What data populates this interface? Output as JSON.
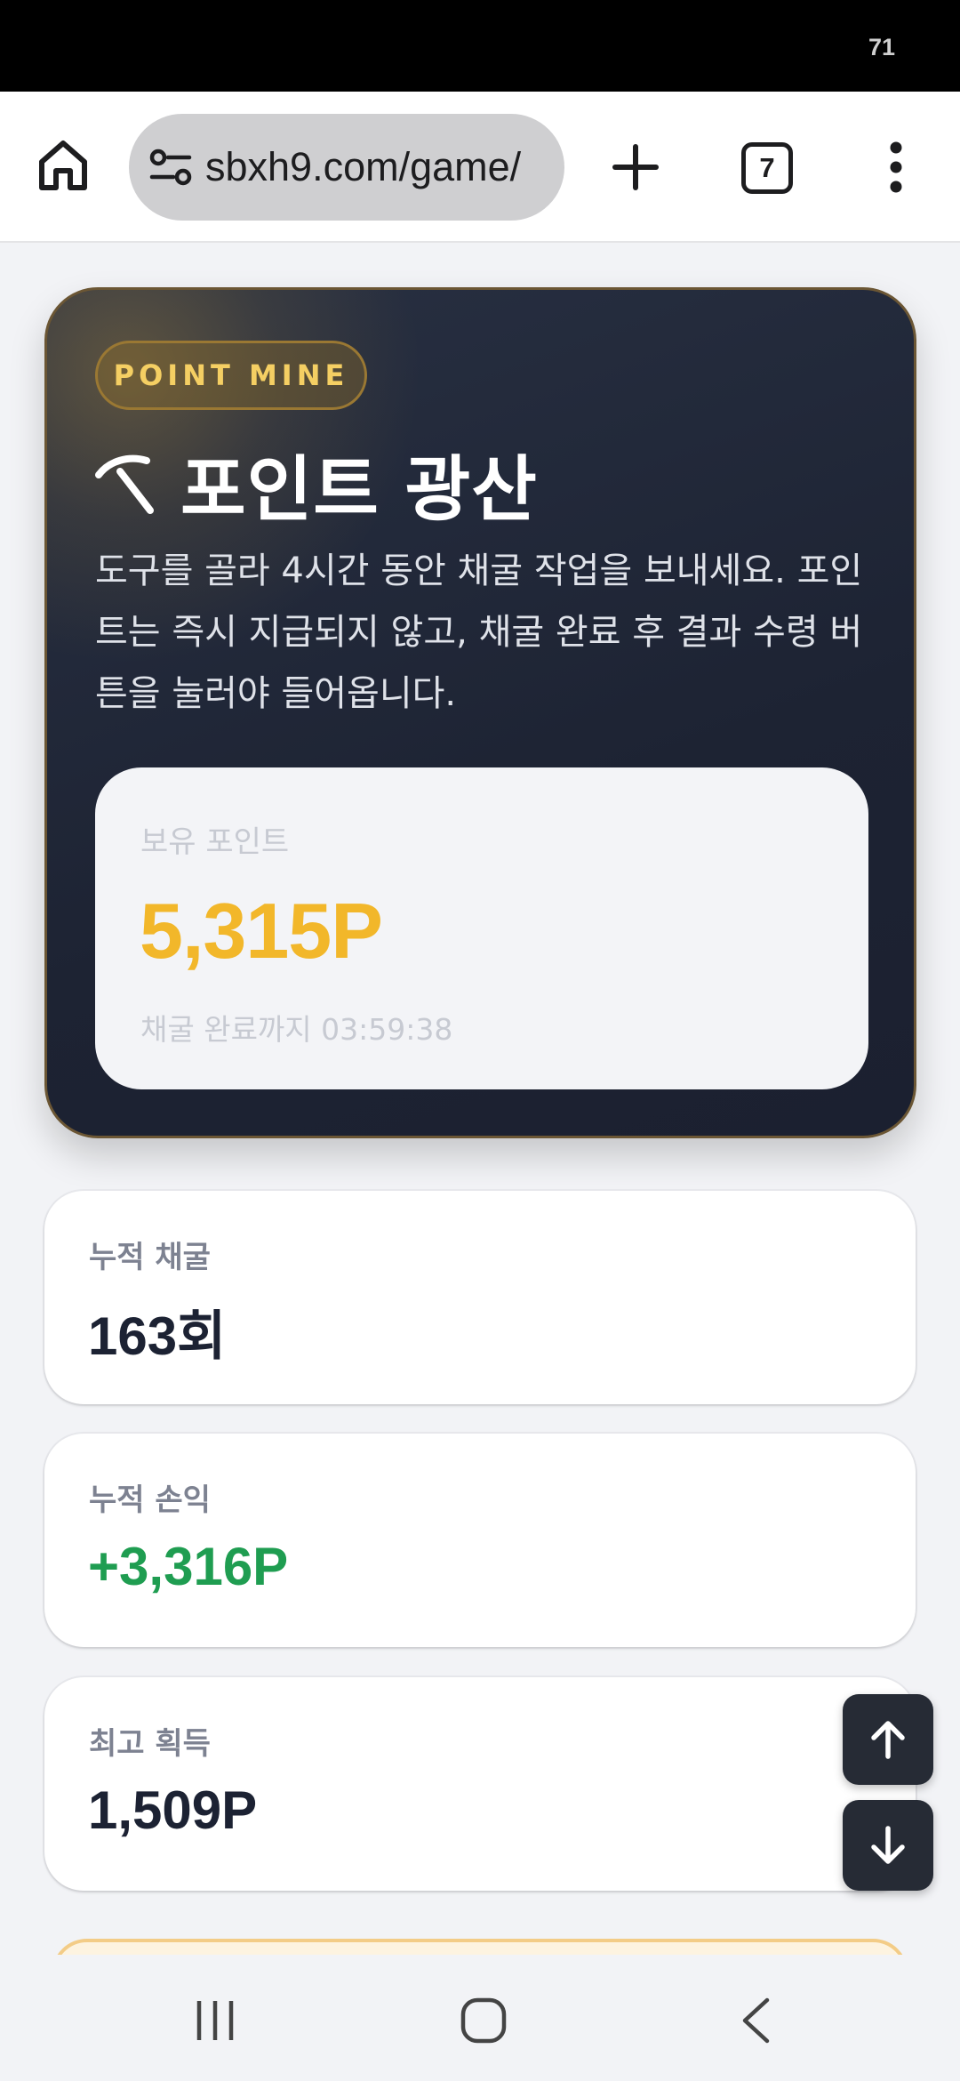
{
  "status_bar": {
    "battery": "71"
  },
  "browser": {
    "url": "sbxh9.com/game/",
    "tab_count": "7"
  },
  "hero": {
    "badge": "POINT MINE",
    "title": "포인트 광산",
    "description": "도구를 골라 4시간 동안 채굴 작업을 보내세요. 포인트는 즉시 지급되지 않고, 채굴 완료 후 결과 수령 버튼을 눌러야 들어옵니다.",
    "points_label": "보유 포인트",
    "points_value": "5,315P",
    "timer_text": "채굴 완료까지 03:59:38"
  },
  "stats": [
    {
      "label": "누적 채굴",
      "value": "163회"
    },
    {
      "label": "누적 손익",
      "value": "+3,316P"
    },
    {
      "label": "최고 획득",
      "value": "1,509P"
    }
  ],
  "colors": {
    "hero_bg": "#1d2333",
    "points_gold": "#f2b72a",
    "profit_green": "#1f9d51",
    "badge_text": "#f5cf63"
  },
  "icons": {
    "home": "home-icon",
    "site_settings": "tune-icon",
    "new_tab": "plus-icon",
    "menu": "more-vert-icon",
    "title": "pickaxe-icon",
    "scroll_up": "arrow-up-icon",
    "scroll_down": "arrow-down-icon"
  }
}
